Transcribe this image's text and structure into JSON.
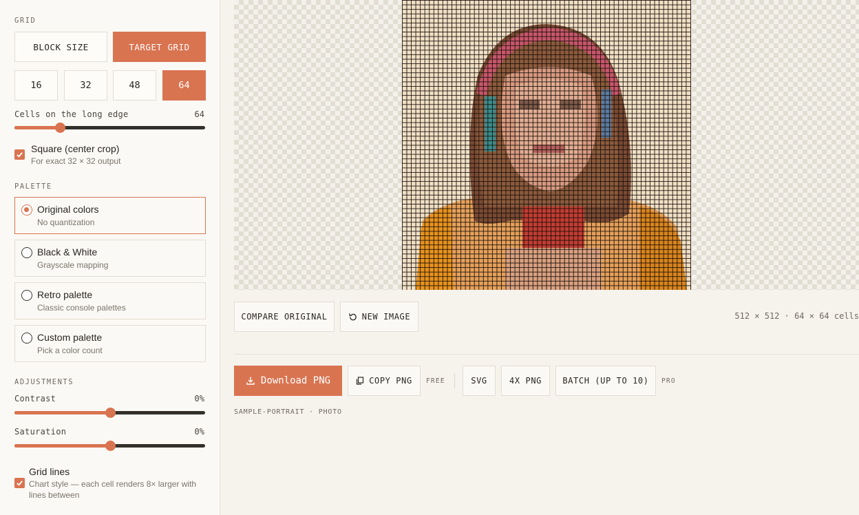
{
  "sidebar": {
    "grid_label": "GRID",
    "mode_buttons": [
      {
        "label": "BLOCK SIZE",
        "active": false
      },
      {
        "label": "TARGET GRID",
        "active": true
      }
    ],
    "size_buttons": [
      {
        "label": "16",
        "active": false
      },
      {
        "label": "32",
        "active": false
      },
      {
        "label": "48",
        "active": false
      },
      {
        "label": "64",
        "active": true
      }
    ],
    "cells_slider": {
      "label": "Cells on the long edge",
      "value": "64",
      "fraction": 0.24
    },
    "square_crop": {
      "title": "Square (center crop)",
      "subtitle": "For exact 32 × 32 output",
      "checked": true
    },
    "palette_label": "PALETTE",
    "palettes": [
      {
        "title": "Original colors",
        "subtitle": "No quantization",
        "selected": true
      },
      {
        "title": "Black & White",
        "subtitle": "Grayscale mapping",
        "selected": false
      },
      {
        "title": "Retro palette",
        "subtitle": "Classic console palettes",
        "selected": false
      },
      {
        "title": "Custom palette",
        "subtitle": "Pick a color count",
        "selected": false
      }
    ],
    "adjustments_label": "ADJUSTMENTS",
    "contrast": {
      "label": "Contrast",
      "value": "0%",
      "fraction": 0.5
    },
    "saturation": {
      "label": "Saturation",
      "value": "0%",
      "fraction": 0.5
    },
    "grid_lines": {
      "title": "Grid lines",
      "subtitle_line1": "Chart style — each cell renders 8× larger with",
      "subtitle_line2": "lines between",
      "checked": true
    }
  },
  "main": {
    "compare_label": "COMPARE ORIGINAL",
    "new_image_label": "NEW IMAGE",
    "dimensions": "512 × 512 · 64 × 64 cells",
    "download_label": "Download PNG",
    "copy_label": "COPY PNG",
    "free_label": "FREE",
    "svg_label": "SVG",
    "png4x_label": "4X PNG",
    "batch_label": "BATCH (UP TO 10)",
    "pro_label": "PRO",
    "caption": "SAMPLE-PORTRAIT · PHOTO"
  },
  "colors": {
    "accent": "#d97451",
    "background": "#f6f3ec",
    "sidebar_bg": "#fbf9f5",
    "border": "#e3ddd2"
  },
  "icons": {
    "refresh": "refresh-icon",
    "download": "download-icon",
    "copy": "copy-icon",
    "check": "check-icon"
  }
}
